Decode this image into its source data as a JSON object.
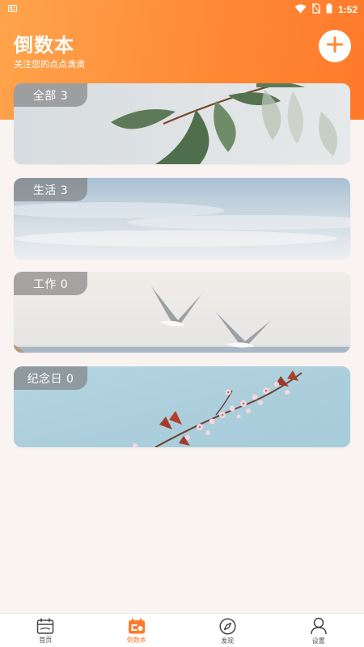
{
  "status_bar": {
    "time": "1:52",
    "icons": [
      "notification-icon",
      "wifi-icon",
      "no-sim-icon",
      "battery-icon"
    ]
  },
  "header": {
    "title": "倒数本",
    "subtitle": "关注您的点点滴滴",
    "add_button_icon": "plus-icon",
    "gradient_colors": [
      "#ffa44c",
      "#ff7a2a"
    ]
  },
  "categories": [
    {
      "label": "全部 3",
      "image": "leaves"
    },
    {
      "label": "生活 3",
      "image": "sky"
    },
    {
      "label": "工作 0",
      "image": "seagulls"
    },
    {
      "label": "纪念日 0",
      "image": "blossom"
    }
  ],
  "bottom_nav": {
    "active_color": "#ff7a2a",
    "items": [
      {
        "label": "首页",
        "icon": "calendar-home-icon",
        "active": false
      },
      {
        "label": "倒数本",
        "icon": "countdown-book-icon",
        "active": true
      },
      {
        "label": "发现",
        "icon": "compass-icon",
        "active": false
      },
      {
        "label": "设置",
        "icon": "user-icon",
        "active": false
      }
    ]
  }
}
